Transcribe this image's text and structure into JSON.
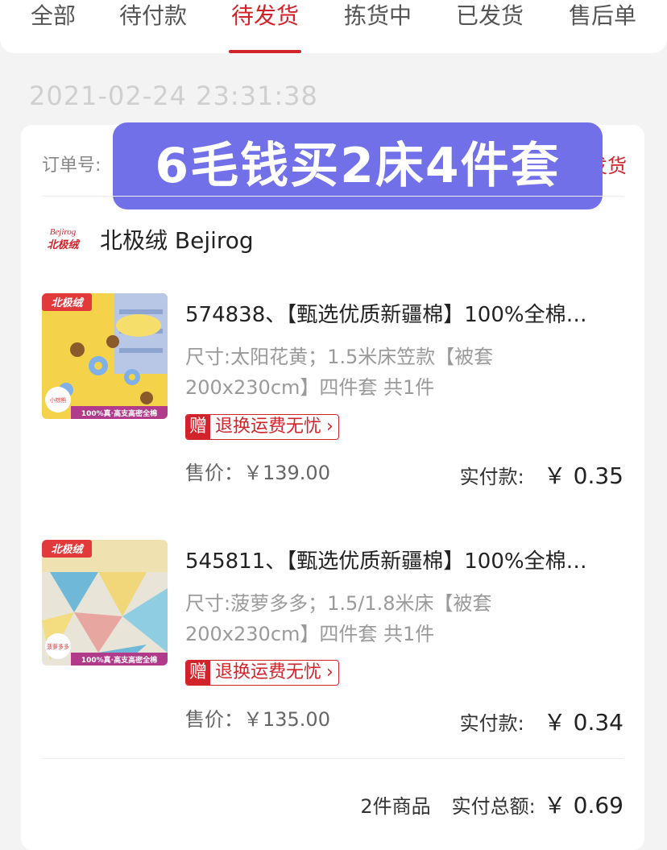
{
  "tabs": [
    "全部",
    "待付款",
    "待发货",
    "拣货中",
    "已发货",
    "售后单"
  ],
  "active_tab": "待发货",
  "order": {
    "timestamp": "2021-02-24 23:31:38",
    "order_no_label": "订单号:",
    "status_text": "待发货",
    "promo_banner": "6毛钱买2床4件套",
    "shop": {
      "logo_text_top": "Bejirog",
      "logo_text_bottom": "北极绒",
      "name": "北极绒 Bejirog"
    },
    "items": [
      {
        "title": "574838、【甄选优质新疆棉】100%全棉…",
        "spec_line1": "尺寸:太阳花黄；1.5米床笠款【被套",
        "spec_line2": "200x230cm】四件套  共1件",
        "gift_tag": "赠",
        "gift_text": "退换运费无忧",
        "price_label": "售价：￥139.00",
        "paid_label": "实付款:",
        "paid_amount": "￥ 0.35",
        "thumb_brand": "北极绒",
        "thumb_badge": "小棕熊",
        "thumb_slogan": "100%真·高支高密全棉"
      },
      {
        "title": "545811、【甄选优质新疆棉】100%全棉…",
        "spec_line1": "尺寸:菠萝多多；1.5/1.8米床【被套",
        "spec_line2": "200x230cm】四件套  共1件",
        "gift_tag": "赠",
        "gift_text": "退换运费无忧",
        "price_label": "售价：￥135.00",
        "paid_label": "实付款:",
        "paid_amount": "￥ 0.34",
        "thumb_brand": "北极绒",
        "thumb_badge": "菠萝多多",
        "thumb_slogan": "100%真·高支高密全棉"
      }
    ],
    "summary": {
      "count_text": "2件商品",
      "total_label": "实付总额:",
      "total_amount": "￥ 0.69"
    }
  },
  "colors": {
    "accent_red": "#d2232a",
    "banner_purple": "#7270e8"
  }
}
